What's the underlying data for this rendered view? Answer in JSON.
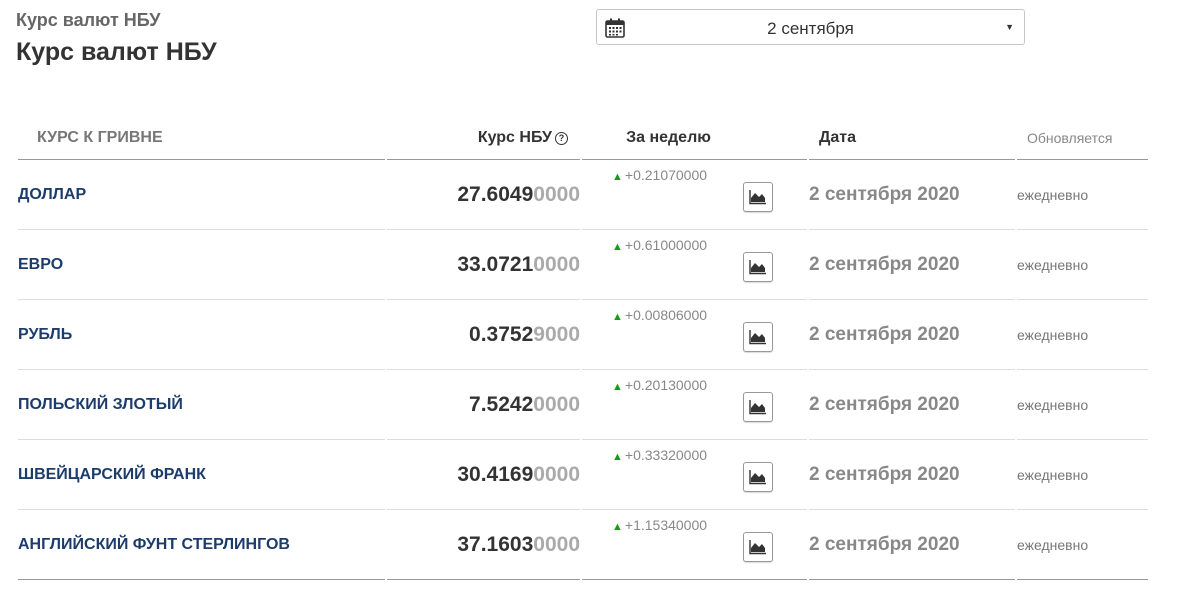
{
  "page": {
    "breadcrumb": "Курс валют НБУ",
    "title": "Курс валют НБУ"
  },
  "datepicker": {
    "value": "2 сентября",
    "icon": "calendar-icon"
  },
  "table": {
    "headers": {
      "name": "КУРС К ГРИВНЕ",
      "rate": "Курс НБУ",
      "week": "За неделю",
      "date": "Дата",
      "updated": "Обновляется"
    },
    "rows": [
      {
        "name": "ДОЛЛАР",
        "rate_main": "27.6049",
        "rate_tail": "0000",
        "delta": "+0.21070000",
        "date": "2 сентября 2020",
        "updated": "ежедневно"
      },
      {
        "name": "ЕВРО",
        "rate_main": "33.0721",
        "rate_tail": "0000",
        "delta": "+0.61000000",
        "date": "2 сентября 2020",
        "updated": "ежедневно"
      },
      {
        "name": "РУБЛЬ",
        "rate_main": "0.3752",
        "rate_tail": "9000",
        "delta": "+0.00806000",
        "date": "2 сентября 2020",
        "updated": "ежедневно"
      },
      {
        "name": "ПОЛЬСКИЙ ЗЛОТЫЙ",
        "rate_main": "7.5242",
        "rate_tail": "0000",
        "delta": "+0.20130000",
        "date": "2 сентября 2020",
        "updated": "ежедневно"
      },
      {
        "name": "ШВЕЙЦАРСКИЙ ФРАНК",
        "rate_main": "30.4169",
        "rate_tail": "0000",
        "delta": "+0.33320000",
        "date": "2 сентября 2020",
        "updated": "ежедневно"
      },
      {
        "name": "АНГЛИЙСКИЙ ФУНТ СТЕРЛИНГОВ",
        "rate_main": "37.1603",
        "rate_tail": "0000",
        "delta": "+1.15340000",
        "date": "2 сентября 2020",
        "updated": "ежедневно"
      }
    ]
  },
  "colors": {
    "currency_name": "#1c3c6b",
    "delta_up": "#1a9a1a",
    "rate_tail": "#aaaaaa"
  }
}
